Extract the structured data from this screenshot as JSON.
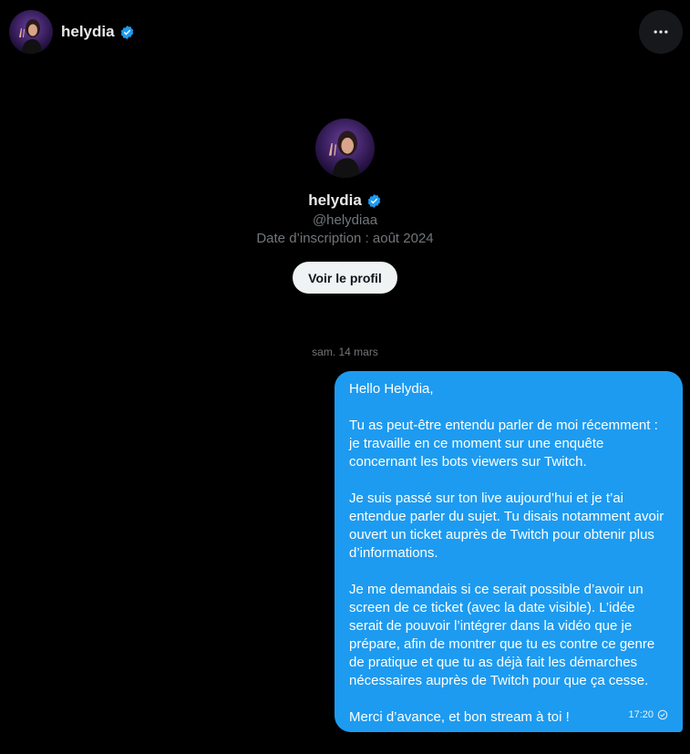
{
  "header": {
    "name": "helydia"
  },
  "profile": {
    "name": "helydia",
    "handle": "@helydiaa",
    "joined": "Date d’inscription : août 2024",
    "view_profile_label": "Voir le profil"
  },
  "conversation": {
    "date_separator": "sam. 14 mars",
    "messages": [
      {
        "paragraphs": [
          "Hello Helydia,",
          "Tu as peut-être entendu parler de moi récemment : je travaille en ce moment sur une enquête concernant les bots viewers sur Twitch.",
          "Je suis passé sur ton live aujourd’hui et je t’ai entendue parler du sujet. Tu disais notamment avoir ouvert un ticket auprès de Twitch pour obtenir plus d’informations.",
          "Je me demandais si ce serait possible d’avoir un screen de ce ticket (avec la date visible). L’idée serait de pouvoir l’intégrer dans la vidéo que je prépare, afin de montrer que tu es contre ce genre de pratique et que tu as déjà fait les démarches nécessaires auprès de Twitch pour que ça cesse.",
          "Merci d’avance, et bon stream à toi !"
        ],
        "time": "17:20",
        "status_icon": "sent-check-icon"
      }
    ]
  },
  "colors": {
    "background": "#000000",
    "bubble": "#1d9bf0",
    "verified": "#1d9bf0",
    "muted": "#71767b"
  },
  "icons": {
    "verified": "verified-badge-icon",
    "more": "more-horizontal-icon"
  }
}
